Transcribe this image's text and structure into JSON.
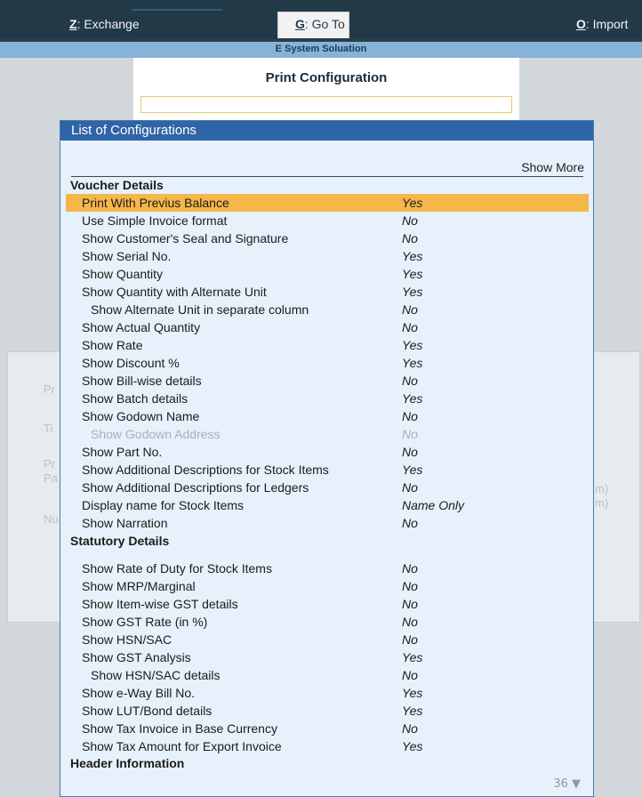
{
  "topbar": {
    "exchange": {
      "key": "Z",
      "label": ": Exchange"
    },
    "goto": {
      "key": "G",
      "label": ": Go To"
    },
    "import": {
      "key": "O",
      "label": ": Import"
    }
  },
  "company_name": "E System Soluation",
  "print_config_title": "Print Configuration",
  "dialog": {
    "title": "List of Configurations",
    "show_more": "Show More",
    "pager": "36 ▼",
    "voucher_details": "Voucher Details",
    "statutory_details": "Statutory Details",
    "header_information": "Header Information",
    "items": [
      {
        "label": "Print With Previus Balance",
        "value": "Yes"
      },
      {
        "label": "Use Simple Invoice format",
        "value": "No"
      },
      {
        "label": "Show Customer's Seal and Signature",
        "value": "No"
      },
      {
        "label": "Show Serial No.",
        "value": "Yes"
      },
      {
        "label": "Show Quantity",
        "value": "Yes"
      },
      {
        "label": "Show Quantity with Alternate Unit",
        "value": "Yes"
      },
      {
        "label": "Show Alternate Unit in separate column",
        "value": "No"
      },
      {
        "label": "Show Actual Quantity",
        "value": "No"
      },
      {
        "label": "Show Rate",
        "value": "Yes"
      },
      {
        "label": "Show Discount %",
        "value": "Yes"
      },
      {
        "label": "Show Bill-wise details",
        "value": "No"
      },
      {
        "label": "Show Batch details",
        "value": "Yes"
      },
      {
        "label": "Show Godown Name",
        "value": "No"
      },
      {
        "label": "Show Godown Address",
        "value": "No"
      },
      {
        "label": "Show Part No.",
        "value": "No"
      },
      {
        "label": "Show Additional Descriptions for Stock Items",
        "value": "Yes"
      },
      {
        "label": "Show Additional Descriptions for Ledgers",
        "value": "No"
      },
      {
        "label": "Display name for Stock Items",
        "value": "Name Only"
      },
      {
        "label": "Show Narration",
        "value": "No"
      }
    ],
    "statutory_items": [
      {
        "label": "Show Rate of Duty for Stock Items",
        "value": "No"
      },
      {
        "label": "Show MRP/Marginal",
        "value": "No"
      },
      {
        "label": "Show Item-wise GST details",
        "value": "No"
      },
      {
        "label": "Show GST Rate (in %)",
        "value": "No"
      },
      {
        "label": "Show HSN/SAC",
        "value": "No"
      },
      {
        "label": "Show GST Analysis",
        "value": "Yes"
      },
      {
        "label": "Show HSN/SAC details",
        "value": "No"
      },
      {
        "label": "Show e-Way Bill No.",
        "value": "Yes"
      },
      {
        "label": "Show LUT/Bond details",
        "value": "Yes"
      },
      {
        "label": "Show Tax Invoice in Base Currency",
        "value": "No"
      },
      {
        "label": "Show Tax Amount for Export Invoice",
        "value": "Yes"
      }
    ]
  },
  "background_fragments": {
    "pr": "Pr",
    "ti": "Ti",
    "pr2": "Pr",
    "pa": "Pa",
    "nu": "Nu",
    "m1": "m)",
    "m2": "m)"
  }
}
